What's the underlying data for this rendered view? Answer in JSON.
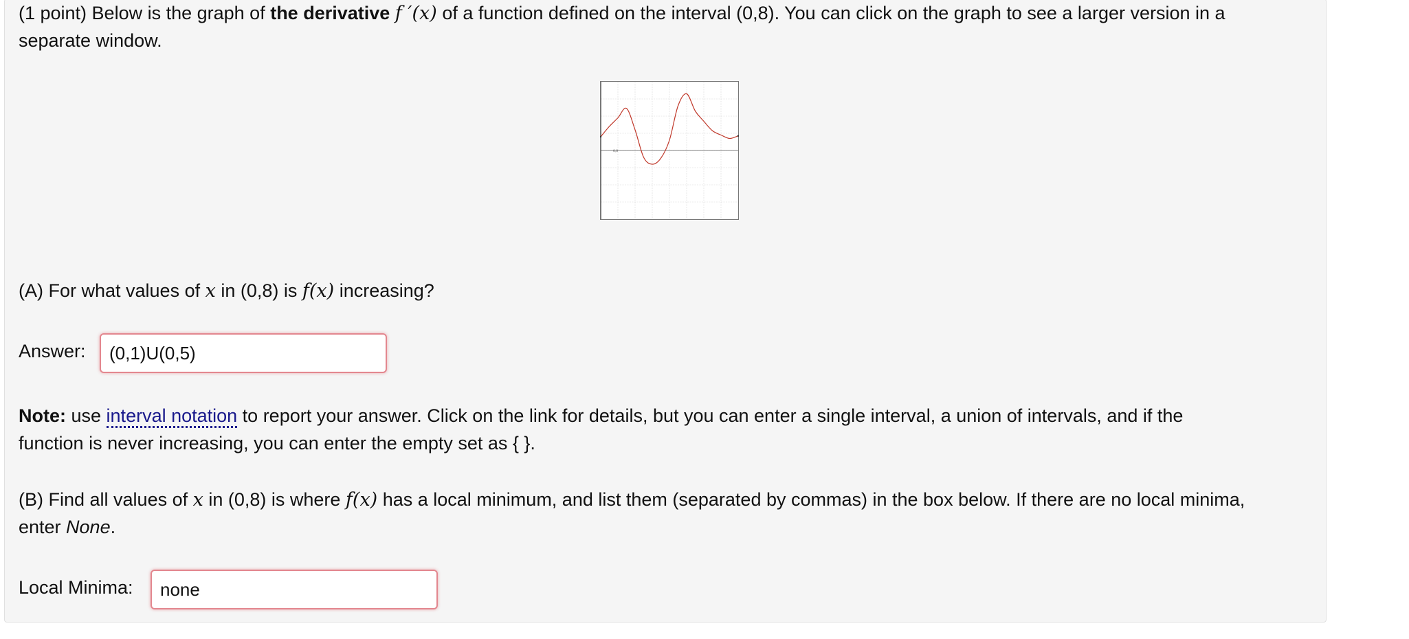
{
  "intro": {
    "prefix": "(1 point) Below is the graph of ",
    "bold": "the derivative",
    "fprime": "f ′(x)",
    "suffix": " of a function defined on the interval (0,8). You can click on the graph to see a larger version in a",
    "line2": "separate window."
  },
  "part_a": {
    "q_prefix": "(A) For what values of ",
    "q_var": "x",
    "q_mid": " in (0,8) is ",
    "q_fx": "f(x)",
    "q_suffix": " increasing?",
    "answer_label": "Answer:",
    "answer_value": "(0,1)U(0,5)"
  },
  "note": {
    "bold": "Note:",
    "pre_link": " use ",
    "link_text": "interval notation",
    "post_link": " to report your answer. Click on the link for details, but you can enter a single interval, a union of intervals, and if the",
    "line2": "function is never increasing, you can enter the empty set as { }."
  },
  "part_b": {
    "q_prefix": "(B) Find all values of ",
    "q_var": "x",
    "q_mid": " in (0,8) is where ",
    "q_fx": "f(x)",
    "q_suffix": " has a local minimum, and list them (separated by commas) in the box below. If there are no local minima,",
    "line2_prefix": "enter ",
    "line2_em": "None",
    "line2_suffix": ".",
    "answer_label": "Local Minima:",
    "answer_value": "none"
  },
  "colors": {
    "curve": "#c0392b",
    "input_border": "#e3878f",
    "link": "#1a1a8c"
  },
  "chart_data": {
    "type": "line",
    "title": "",
    "xlabel": "",
    "ylabel": "",
    "xlim": [
      0,
      8
    ],
    "ylim": [
      -4,
      4
    ],
    "grid": true,
    "tick_labels": [
      "0,0"
    ],
    "series": [
      {
        "x": [
          0,
          0.5,
          1,
          1.5,
          2,
          2.5,
          3,
          3.5,
          4,
          4.5,
          5,
          5.5,
          6,
          6.5,
          7,
          7.5,
          8
        ],
        "y": [
          0.8,
          1.4,
          1.9,
          2.45,
          1.2,
          -0.4,
          -0.8,
          -0.45,
          0.6,
          2.6,
          3.3,
          2.3,
          1.7,
          1.15,
          0.9,
          0.7,
          0.85
        ]
      }
    ]
  }
}
